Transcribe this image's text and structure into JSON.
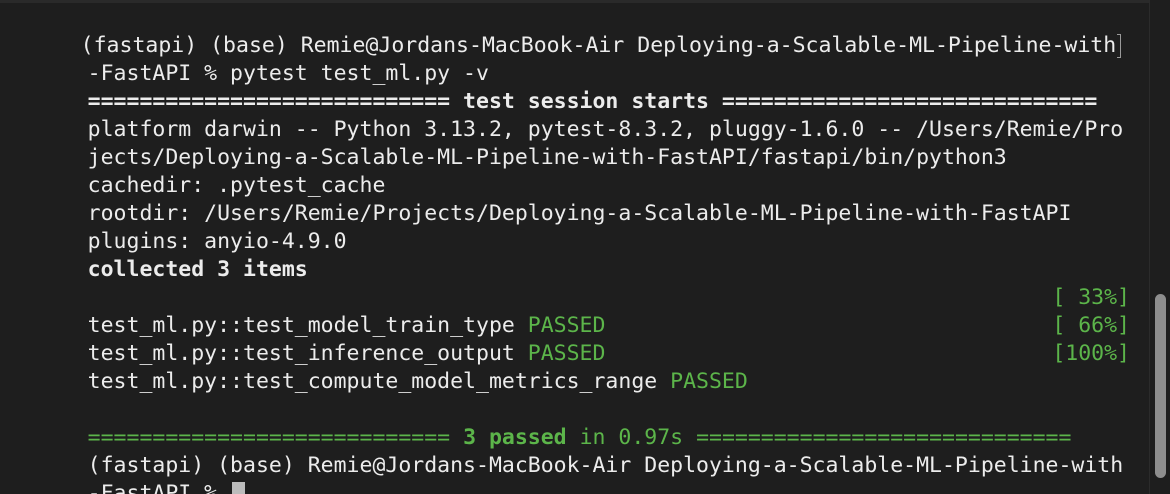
{
  "terminal": {
    "lines": [
      {
        "text": "(fastapi) (base) Remie@Jordans-MacBook-Air Deploying-a-Scalable-ML-Pipeline-with"
      },
      {
        "text": "-FastAPI % pytest test_ml.py -v"
      },
      {
        "text": "============================ test session starts ============================="
      },
      {
        "text": "platform darwin -- Python 3.13.2, pytest-8.3.2, pluggy-1.6.0 -- /Users/Remie/Pro"
      },
      {
        "text": "jects/Deploying-a-Scalable-ML-Pipeline-with-FastAPI/fastapi/bin/python3"
      },
      {
        "text": "cachedir: .pytest_cache"
      },
      {
        "text": "rootdir: /Users/Remie/Projects/Deploying-a-Scalable-ML-Pipeline-with-FastAPI"
      },
      {
        "text": "plugins: anyio-4.9.0"
      },
      {
        "text": "collected 3 items"
      },
      {
        "text": ""
      },
      {
        "text": "test_ml.py::test_model_train_type ",
        "status": "PASSED",
        "progress": "[ 33%]"
      },
      {
        "text": "test_ml.py::test_inference_output ",
        "status": "PASSED",
        "progress": "[ 66%]"
      },
      {
        "text": "test_ml.py::test_compute_model_metrics_range ",
        "status": "PASSED",
        "progress": "[100%]"
      },
      {
        "text": ""
      },
      {
        "summary_left": "============================ ",
        "summary_count": "3 passed",
        "summary_time": " in 0.97s",
        "summary_right": " ============================="
      },
      {
        "text": "(fastapi) (base) Remie@Jordans-MacBook-Air Deploying-a-Scalable-ML-Pipeline-with"
      },
      {
        "text": "-FastAPI % "
      }
    ]
  },
  "colors": {
    "background": "#1e1e1e",
    "text": "#ececec",
    "passed": "#5cb54a",
    "cursor": "#bcbcbc"
  },
  "scrollbar": {
    "visible_fraction": 0.37,
    "position": "bottom"
  }
}
